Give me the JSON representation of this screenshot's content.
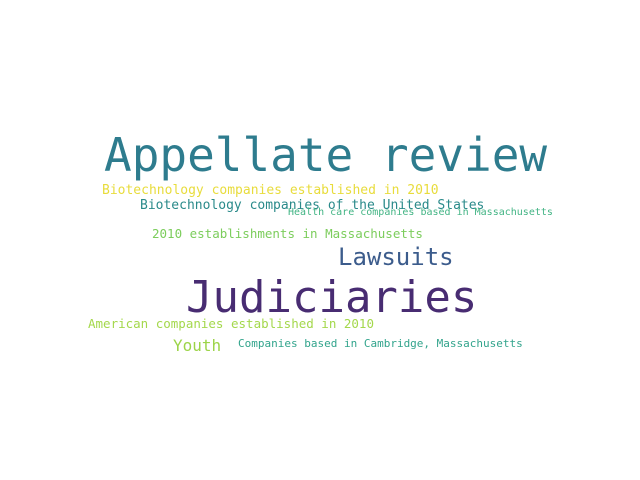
{
  "words": [
    {
      "text": "Appellate review",
      "color": "#2e7c8e"
    },
    {
      "text": "Judiciaries",
      "color": "#482c72"
    },
    {
      "text": "Lawsuits",
      "color": "#3c5c8c"
    },
    {
      "text": "Biotechnology companies established in 2010",
      "color": "#e8dc3c"
    },
    {
      "text": "Biotechnology companies of the United States",
      "color": "#2a8a8a"
    },
    {
      "text": "Health care companies based in Massachusetts",
      "color": "#42b484"
    },
    {
      "text": "2010 establishments in Massachusetts",
      "color": "#7ccd5c"
    },
    {
      "text": "American companies established in 2010",
      "color": "#a4d84c"
    },
    {
      "text": "Youth",
      "color": "#9cd448"
    },
    {
      "text": "Companies based in Cambridge, Massachusetts",
      "color": "#32a48c"
    }
  ]
}
